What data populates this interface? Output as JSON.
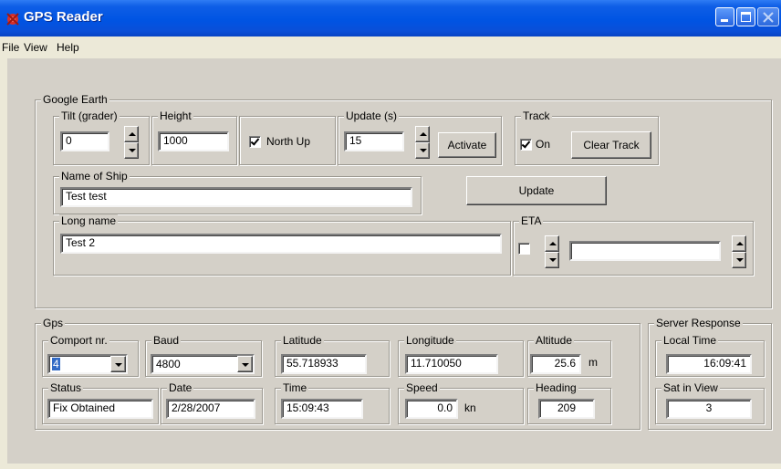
{
  "window": {
    "title": "GPS Reader",
    "app_icon": "satellite-icon",
    "controls": [
      "minimize-icon",
      "maximize-icon",
      "close-icon"
    ]
  },
  "menu": [
    "File",
    "View",
    "Help"
  ],
  "google_earth": {
    "group_label": "Google Earth",
    "tilt": {
      "label": "Tilt (grader)",
      "value": "0"
    },
    "height": {
      "label": "Height",
      "value": "1000"
    },
    "north_up": {
      "label": "North Up",
      "checked": true
    },
    "update_s": {
      "label": "Update (s)",
      "value": "15"
    },
    "activate_button": "Activate",
    "track": {
      "label": "Track",
      "on_label": "On",
      "on_checked": true,
      "clear_button": "Clear Track"
    },
    "name_of_ship": {
      "label": "Name of Ship",
      "value": "Test test"
    },
    "update_button": "Update",
    "long_name": {
      "label": "Long name",
      "value": "Test 2"
    },
    "eta": {
      "label": "ETA",
      "checked": false,
      "value": ""
    }
  },
  "gps": {
    "group_label": "Gps",
    "comport": {
      "label": "Comport nr.",
      "value": "4"
    },
    "baud": {
      "label": "Baud",
      "value": "4800"
    },
    "latitude": {
      "label": "Latitude",
      "value": "55.718933"
    },
    "longitude": {
      "label": "Longitude",
      "value": "11.710050"
    },
    "altitude": {
      "label": "Altitude",
      "value": "25.6",
      "unit": "m"
    },
    "status": {
      "label": "Status",
      "value": "Fix Obtained"
    },
    "date": {
      "label": "Date",
      "value": "2/28/2007"
    },
    "time": {
      "label": "Time",
      "value": "15:09:43"
    },
    "speed": {
      "label": "Speed",
      "value": "0.0",
      "unit": "kn"
    },
    "heading": {
      "label": "Heading",
      "value": "209"
    }
  },
  "server_response": {
    "group_label": "Server Response",
    "local_time": {
      "label": "Local Time",
      "value": "16:09:41"
    },
    "sat_in_view": {
      "label": "Sat in View",
      "value": "3"
    }
  },
  "colors": {
    "titlebar": "#0054e3",
    "dialog_face": "#d4d0c8",
    "selection": "#316ac5"
  }
}
